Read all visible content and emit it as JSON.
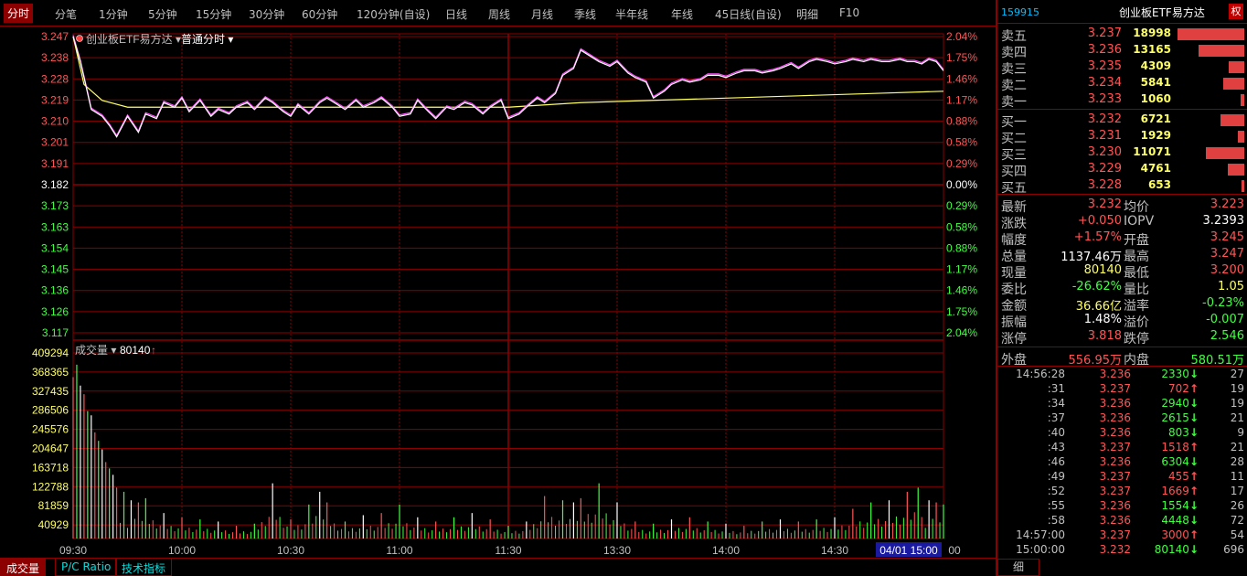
{
  "tabs": [
    "分时",
    "分笔",
    "1分钟",
    "5分钟",
    "15分钟",
    "30分钟",
    "60分钟",
    "120分钟(自设)",
    "日线",
    "周线",
    "月线",
    "季线",
    "半年线",
    "年线",
    "45日线(自设)",
    "明细",
    "F10"
  ],
  "chart_header": {
    "name": "创业板ETF易方达",
    "mode": "普通分时"
  },
  "volume_header": {
    "label": "成交量",
    "value": "80140"
  },
  "price_axis": {
    "left": [
      "3.247",
      "3.238",
      "3.228",
      "3.219",
      "3.210",
      "3.201",
      "3.191",
      "3.182",
      "3.173",
      "3.163",
      "3.154",
      "3.145",
      "3.136",
      "3.126",
      "3.117"
    ],
    "right": [
      "2.04%",
      "1.75%",
      "1.46%",
      "1.17%",
      "0.88%",
      "0.58%",
      "0.29%",
      "0.00%",
      "0.29%",
      "0.58%",
      "0.88%",
      "1.17%",
      "1.46%",
      "1.75%",
      "2.04%"
    ]
  },
  "volume_axis": [
    "409294",
    "368365",
    "327435",
    "286506",
    "245576",
    "204647",
    "163718",
    "122788",
    "81859",
    "40929"
  ],
  "time_axis": [
    "09:30",
    "10:00",
    "10:30",
    "11:00",
    "11:30",
    "13:30",
    "14:00",
    "14:30",
    "00"
  ],
  "time_badge": "04/01 15:00",
  "bottom_tabs": [
    "成交量",
    "P/C Ratio",
    "技术指标"
  ],
  "colors": {
    "up": "#ff5555",
    "down": "#40ff40",
    "grid": "#8c0000",
    "price_line": "#ffffff",
    "avg_line": "#ffff66",
    "price_shadow": "#ff55ff"
  },
  "chart_data": {
    "type": "line",
    "prev_close": 3.182,
    "ylim": [
      3.117,
      3.247
    ],
    "volume_ylim": [
      0,
      450000
    ],
    "price": [
      [
        0,
        3.247
      ],
      [
        2,
        3.236
      ],
      [
        5,
        3.215
      ],
      [
        8,
        3.212
      ],
      [
        10,
        3.208
      ],
      [
        12,
        3.203
      ],
      [
        15,
        3.212
      ],
      [
        18,
        3.205
      ],
      [
        20,
        3.213
      ],
      [
        23,
        3.211
      ],
      [
        25,
        3.218
      ],
      [
        28,
        3.216
      ],
      [
        30,
        3.22
      ],
      [
        32,
        3.214
      ],
      [
        35,
        3.219
      ],
      [
        38,
        3.212
      ],
      [
        40,
        3.215
      ],
      [
        43,
        3.213
      ],
      [
        45,
        3.216
      ],
      [
        48,
        3.218
      ],
      [
        50,
        3.215
      ],
      [
        53,
        3.22
      ],
      [
        55,
        3.218
      ],
      [
        58,
        3.214
      ],
      [
        60,
        3.212
      ],
      [
        62,
        3.217
      ],
      [
        65,
        3.213
      ],
      [
        68,
        3.218
      ],
      [
        70,
        3.22
      ],
      [
        73,
        3.217
      ],
      [
        75,
        3.215
      ],
      [
        78,
        3.219
      ],
      [
        80,
        3.216
      ],
      [
        83,
        3.218
      ],
      [
        85,
        3.22
      ],
      [
        88,
        3.216
      ],
      [
        90,
        3.212
      ],
      [
        93,
        3.213
      ],
      [
        95,
        3.219
      ],
      [
        98,
        3.214
      ],
      [
        100,
        3.211
      ],
      [
        103,
        3.216
      ],
      [
        105,
        3.215
      ],
      [
        108,
        3.218
      ],
      [
        110,
        3.217
      ],
      [
        113,
        3.213
      ],
      [
        115,
        3.216
      ],
      [
        118,
        3.219
      ],
      [
        120,
        3.211
      ],
      [
        123,
        3.213
      ],
      [
        125,
        3.216
      ],
      [
        128,
        3.22
      ],
      [
        130,
        3.218
      ],
      [
        133,
        3.222
      ],
      [
        135,
        3.23
      ],
      [
        138,
        3.233
      ],
      [
        140,
        3.241
      ],
      [
        142,
        3.239
      ],
      [
        145,
        3.236
      ],
      [
        148,
        3.234
      ],
      [
        150,
        3.236
      ],
      [
        153,
        3.231
      ],
      [
        155,
        3.229
      ],
      [
        158,
        3.227
      ],
      [
        160,
        3.22
      ],
      [
        163,
        3.223
      ],
      [
        165,
        3.226
      ],
      [
        168,
        3.228
      ],
      [
        170,
        3.227
      ],
      [
        173,
        3.228
      ],
      [
        175,
        3.23
      ],
      [
        178,
        3.23
      ],
      [
        180,
        3.229
      ],
      [
        183,
        3.231
      ],
      [
        185,
        3.232
      ],
      [
        188,
        3.232
      ],
      [
        190,
        3.231
      ],
      [
        193,
        3.232
      ],
      [
        195,
        3.233
      ],
      [
        198,
        3.235
      ],
      [
        200,
        3.233
      ],
      [
        203,
        3.236
      ],
      [
        205,
        3.237
      ],
      [
        208,
        3.236
      ],
      [
        210,
        3.235
      ],
      [
        213,
        3.236
      ],
      [
        215,
        3.237
      ],
      [
        218,
        3.236
      ],
      [
        220,
        3.237
      ],
      [
        223,
        3.236
      ],
      [
        225,
        3.236
      ],
      [
        228,
        3.237
      ],
      [
        230,
        3.236
      ],
      [
        232,
        3.236
      ],
      [
        234,
        3.235
      ],
      [
        236,
        3.237
      ],
      [
        238,
        3.236
      ],
      [
        240,
        3.232
      ]
    ],
    "avg_price": [
      [
        0,
        3.247
      ],
      [
        3,
        3.226
      ],
      [
        8,
        3.219
      ],
      [
        15,
        3.216
      ],
      [
        30,
        3.216
      ],
      [
        60,
        3.216
      ],
      [
        90,
        3.216
      ],
      [
        120,
        3.216
      ],
      [
        140,
        3.218
      ],
      [
        160,
        3.219
      ],
      [
        180,
        3.22
      ],
      [
        200,
        3.221
      ],
      [
        220,
        3.222
      ],
      [
        240,
        3.223
      ]
    ],
    "volume_peaks": [
      [
        0,
        380000
      ],
      [
        1,
        409294
      ],
      [
        2,
        360000
      ],
      [
        3,
        340000
      ],
      [
        4,
        300000
      ],
      [
        5,
        290000
      ],
      [
        6,
        250000
      ],
      [
        7,
        230000
      ],
      [
        8,
        210000
      ],
      [
        9,
        180000
      ],
      [
        10,
        165000
      ],
      [
        11,
        150000
      ],
      [
        12,
        120000
      ],
      [
        14,
        110000
      ],
      [
        16,
        90000
      ],
      [
        18,
        85000
      ],
      [
        20,
        95000
      ],
      [
        25,
        60000
      ],
      [
        30,
        50000
      ],
      [
        35,
        45000
      ],
      [
        40,
        40000
      ],
      [
        45,
        30000
      ],
      [
        50,
        35000
      ],
      [
        55,
        130000
      ],
      [
        60,
        45000
      ],
      [
        65,
        80000
      ],
      [
        68,
        110000
      ],
      [
        70,
        85000
      ],
      [
        75,
        40000
      ],
      [
        80,
        55000
      ],
      [
        85,
        60000
      ],
      [
        90,
        80000
      ],
      [
        95,
        50000
      ],
      [
        100,
        40000
      ],
      [
        105,
        50000
      ],
      [
        110,
        60000
      ],
      [
        115,
        45000
      ],
      [
        120,
        30000
      ],
      [
        125,
        40000
      ],
      [
        130,
        100000
      ],
      [
        135,
        90000
      ],
      [
        138,
        85000
      ],
      [
        140,
        95000
      ],
      [
        145,
        130000
      ],
      [
        150,
        85000
      ],
      [
        155,
        40000
      ],
      [
        160,
        35000
      ],
      [
        165,
        45000
      ],
      [
        170,
        50000
      ],
      [
        175,
        40000
      ],
      [
        180,
        35000
      ],
      [
        185,
        30000
      ],
      [
        190,
        40000
      ],
      [
        195,
        45000
      ],
      [
        200,
        40000
      ],
      [
        205,
        45000
      ],
      [
        210,
        50000
      ],
      [
        215,
        70000
      ],
      [
        220,
        85000
      ],
      [
        225,
        90000
      ],
      [
        230,
        110000
      ],
      [
        233,
        120000
      ],
      [
        236,
        90000
      ],
      [
        238,
        85000
      ],
      [
        240,
        80140
      ]
    ]
  },
  "right": {
    "code": "159915",
    "name": "创业板ETF易方达",
    "quan": "权",
    "sell": [
      {
        "label": "卖五",
        "price": "3.237",
        "vol": "18998",
        "bar": 1.0
      },
      {
        "label": "卖四",
        "price": "3.236",
        "vol": "13165",
        "bar": 0.69
      },
      {
        "label": "卖三",
        "price": "3.235",
        "vol": "4309",
        "bar": 0.23
      },
      {
        "label": "卖二",
        "price": "3.234",
        "vol": "5841",
        "bar": 0.31
      },
      {
        "label": "卖一",
        "price": "3.233",
        "vol": "1060",
        "bar": 0.06
      }
    ],
    "buy": [
      {
        "label": "买一",
        "price": "3.232",
        "vol": "6721",
        "bar": 0.35
      },
      {
        "label": "买二",
        "price": "3.231",
        "vol": "1929",
        "bar": 0.1
      },
      {
        "label": "买三",
        "price": "3.230",
        "vol": "11071",
        "bar": 0.58
      },
      {
        "label": "买四",
        "price": "3.229",
        "vol": "4761",
        "bar": 0.25
      },
      {
        "label": "买五",
        "price": "3.228",
        "vol": "653",
        "bar": 0.03
      }
    ],
    "quote": [
      {
        "k": "最新",
        "v": "3.232",
        "vc": "red",
        "k2": "均价",
        "v2": "3.223",
        "v2c": "red"
      },
      {
        "k": "涨跌",
        "v": "+0.050",
        "vc": "red",
        "k2": "IOPV",
        "v2": "3.2393",
        "v2c": "white"
      },
      {
        "k": "幅度",
        "v": "+1.57%",
        "vc": "red",
        "k2": "开盘",
        "v2": "3.245",
        "v2c": "red"
      },
      {
        "k": "总量",
        "v": "1137.46万",
        "vc": "white",
        "k2": "最高",
        "v2": "3.247",
        "v2c": "red"
      },
      {
        "k": "现量",
        "v": "80140",
        "vc": "yellow",
        "k2": "最低",
        "v2": "3.200",
        "v2c": "red"
      },
      {
        "k": "委比",
        "v": "-26.62%",
        "vc": "green",
        "k2": "量比",
        "v2": "1.05",
        "v2c": "yellow"
      },
      {
        "k": "金额",
        "v": "36.66亿",
        "vc": "yellow",
        "k2": "溢率",
        "v2": "-0.23%",
        "v2c": "green"
      },
      {
        "k": "振幅",
        "v": "1.48%",
        "vc": "white",
        "k2": "溢价",
        "v2": "-0.007",
        "v2c": "green"
      },
      {
        "k": "涨停",
        "v": "3.818",
        "vc": "red",
        "k2": "跌停",
        "v2": "2.546",
        "v2c": "green"
      }
    ],
    "outer": {
      "k": "外盘",
      "v": "556.95万",
      "k2": "内盘",
      "v2": "580.51万"
    },
    "ticks": [
      {
        "t": "14:56:28",
        "p": "3.236",
        "v": "2330",
        "d": "down",
        "n": "27"
      },
      {
        "t": ":31",
        "p": "3.237",
        "v": "702",
        "d": "up",
        "n": "19"
      },
      {
        "t": ":34",
        "p": "3.236",
        "v": "2940",
        "d": "down",
        "n": "19"
      },
      {
        "t": ":37",
        "p": "3.236",
        "v": "2615",
        "d": "down",
        "n": "21"
      },
      {
        "t": ":40",
        "p": "3.236",
        "v": "803",
        "d": "down",
        "n": "9"
      },
      {
        "t": ":43",
        "p": "3.237",
        "v": "1518",
        "d": "up",
        "n": "21"
      },
      {
        "t": ":46",
        "p": "3.236",
        "v": "6304",
        "d": "down",
        "n": "28"
      },
      {
        "t": ":49",
        "p": "3.237",
        "v": "455",
        "d": "up",
        "n": "11"
      },
      {
        "t": ":52",
        "p": "3.237",
        "v": "1669",
        "d": "up",
        "n": "17"
      },
      {
        "t": ":55",
        "p": "3.236",
        "v": "1554",
        "d": "down",
        "n": "26"
      },
      {
        "t": ":58",
        "p": "3.236",
        "v": "4448",
        "d": "down",
        "n": "72"
      },
      {
        "t": "14:57:00",
        "p": "3.237",
        "v": "3000",
        "d": "up",
        "n": "54"
      },
      {
        "t": "15:00:00",
        "p": "3.232",
        "v": "80140",
        "d": "down",
        "n": "696"
      }
    ],
    "detail_tab": "细"
  }
}
